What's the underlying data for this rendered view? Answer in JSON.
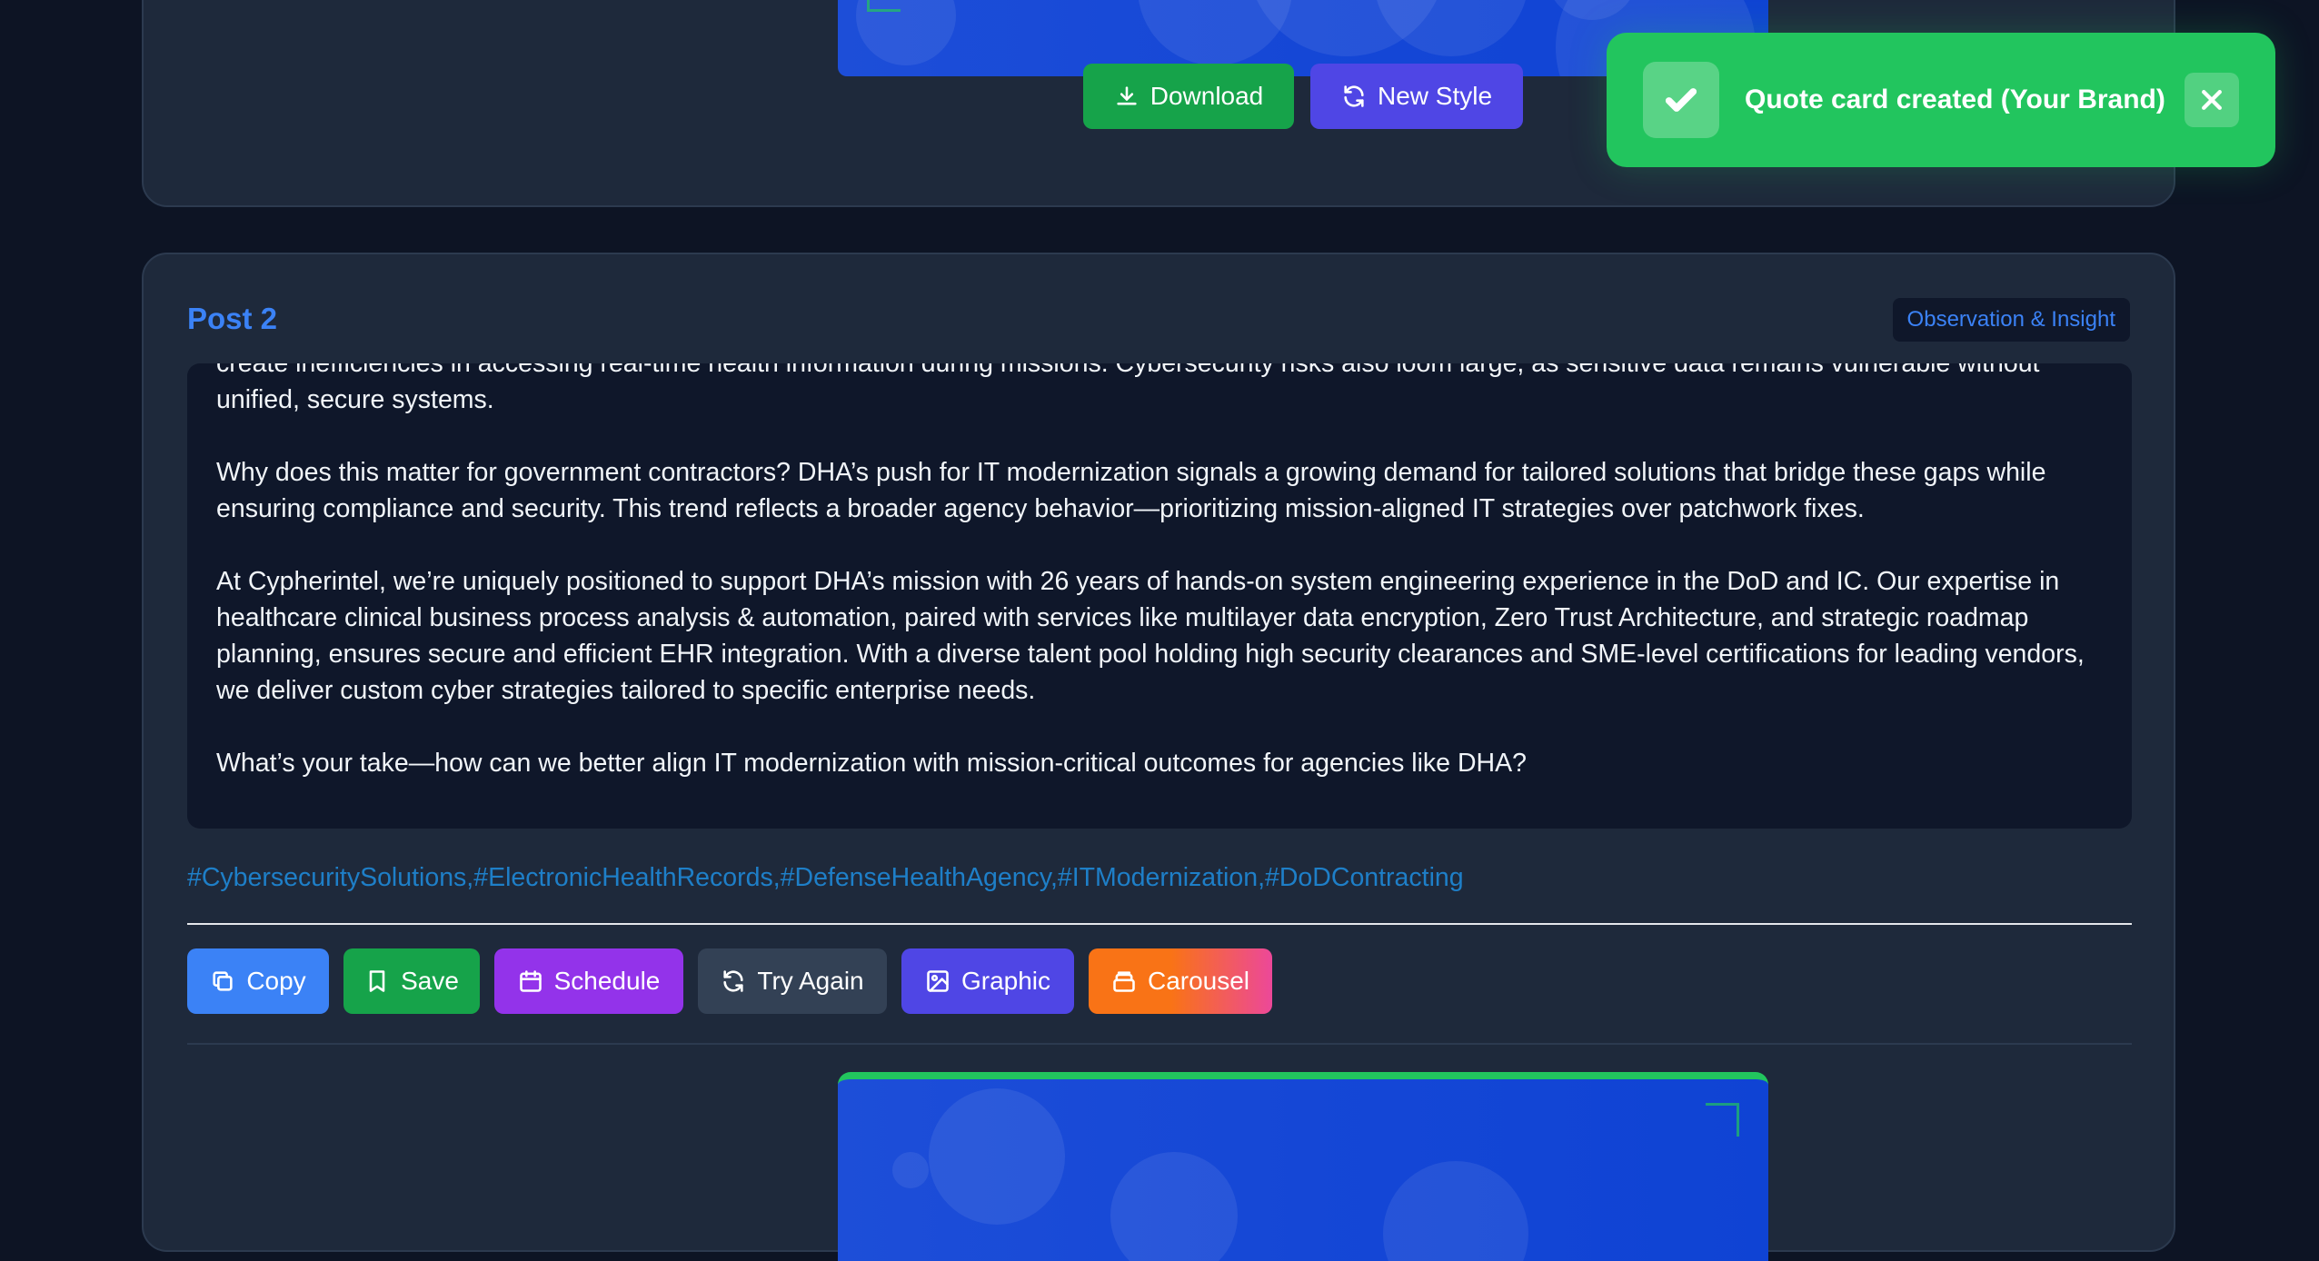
{
  "top_card": {
    "download_label": "Download",
    "new_style_label": "New Style"
  },
  "post": {
    "title": "Post 2",
    "category": "Observation & Insight",
    "paragraphs": [
      "create inefficiencies in accessing real-time health information during missions. Cybersecurity risks also loom large, as sensitive data remains vulnerable without unified, secure systems.",
      "Why does this matter for government contractors? DHA’s push for IT modernization signals a growing demand for tailored solutions that bridge these gaps while ensuring compliance and security. This trend reflects a broader agency behavior—prioritizing mission-aligned IT strategies over patchwork fixes.",
      "At Cypherintel, we’re uniquely positioned to support DHA’s mission with 26 years of hands-on system engineering experience in the DoD and IC. Our expertise in healthcare clinical business process analysis & automation, paired with services like multilayer data encryption, Zero Trust Architecture, and strategic roadmap planning, ensures secure and efficient EHR integration. With a diverse talent pool holding high security clearances and SME-level certifications for leading vendors, we deliver custom cyber strategies tailored to specific enterprise needs.",
      "What’s your take—how can we better align IT modernization with mission-critical outcomes for agencies like DHA?"
    ],
    "hashtags": "#CybersecuritySolutions,#ElectronicHealthRecords,#DefenseHealthAgency,#ITModernization,#DoDContracting",
    "actions": {
      "copy": "Copy",
      "save": "Save",
      "schedule": "Schedule",
      "try_again": "Try Again",
      "graphic": "Graphic",
      "carousel": "Carousel"
    }
  },
  "toast": {
    "message": "Quote card created (Your Brand)"
  },
  "colors": {
    "page_bg": "#0d1424",
    "panel_bg": "#1e293b",
    "accent_blue": "#3b82f6",
    "success_green": "#22c55e"
  },
  "icons": [
    "download-icon",
    "refresh-icon",
    "copy-icon",
    "bookmark-icon",
    "calendar-icon",
    "image-icon",
    "layers-icon",
    "check-icon",
    "close-icon"
  ]
}
